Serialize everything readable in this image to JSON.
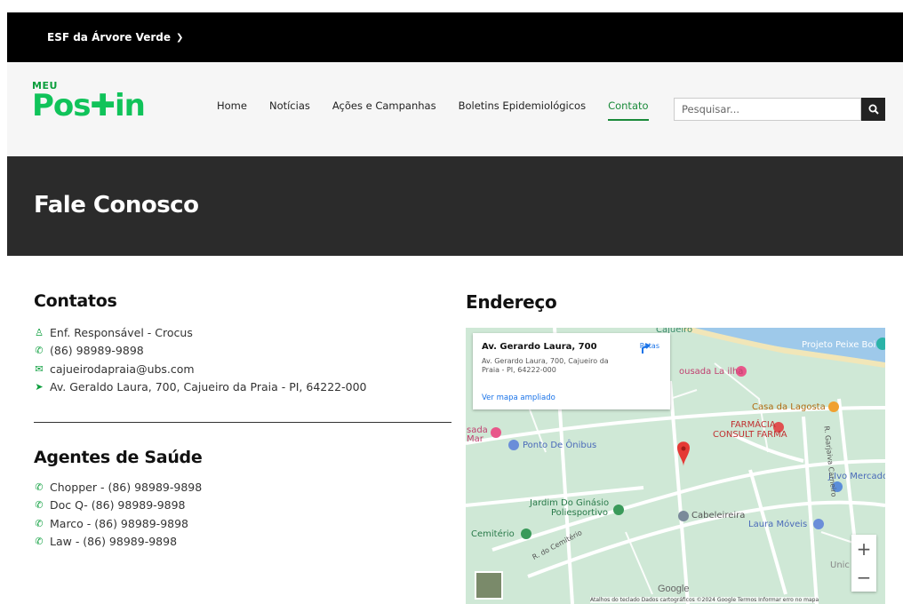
{
  "topbar": {
    "unit": "ESF da Árvore Verde"
  },
  "logo": {
    "small": "MEU",
    "main_a": "Pos",
    "main_b": "in"
  },
  "nav": {
    "items": [
      {
        "label": "Home"
      },
      {
        "label": "Notícias"
      },
      {
        "label": "Ações e Campanhas"
      },
      {
        "label": "Boletins Epidemiológicos"
      },
      {
        "label": "Contato",
        "active": true
      }
    ]
  },
  "search": {
    "placeholder": "Pesquisar..."
  },
  "hero": {
    "title": "Fale Conosco"
  },
  "contacts": {
    "heading": "Contatos",
    "items": [
      {
        "icon": "nurse-icon",
        "text": "Enf. Responsável - Crocus"
      },
      {
        "icon": "whatsapp-icon",
        "text": "(86) 98989-9898"
      },
      {
        "icon": "email-icon",
        "text": "cajueirodapraia@ubs.com"
      },
      {
        "icon": "location-arrow-icon",
        "text": "Av. Geraldo Laura, 700, Cajueiro da Praia - PI, 64222-000"
      }
    ]
  },
  "agents": {
    "heading": "Agentes de Saúde",
    "items": [
      {
        "icon": "whatsapp-icon",
        "text": "Chopper - (86) 98989-9898"
      },
      {
        "icon": "whatsapp-icon",
        "text": "Doc Q- (86) 98989-9898"
      },
      {
        "icon": "whatsapp-icon",
        "text": "Marco - (86) 98989-9898"
      },
      {
        "icon": "whatsapp-icon",
        "text": "Law - (86) 98989-9898"
      }
    ]
  },
  "address": {
    "heading": "Endereço",
    "card_title": "Av. Gerardo Laura, 700",
    "card_address": "Av. Gerardo Laura, 700, Cajueiro da Praia - PI, 64222-000",
    "card_link": "Ver mapa ampliado",
    "card_directions": "Rotas"
  },
  "map": {
    "labels": {
      "cajueiro": "Cajueiro",
      "projeto": "Projeto Peixe Boi",
      "pousada_ilha": "ousada La ilha",
      "casa_lagosta": "Casa da Lagosta",
      "farmacia": "FARMÁCIA",
      "consult": "CONSULT FARMA",
      "pousada_mar_a": "sada",
      "pousada_mar_b": "Mar",
      "ponto_onibus": "Ponto De Ônibus",
      "jivo": "J.Ivo Mercado",
      "rua_garjaiva": "R. Garjaiva Carneiro",
      "jardim_a": "Jardim Do Ginásio",
      "jardim_b": "Poliesportivo",
      "cabeleireira": "Cabeleireira",
      "laura": "Laura Móveis",
      "cemiterio": "Cemitério",
      "rua_cemiterio": "R. do Cemitério",
      "unic": "Unic",
      "google": "Google",
      "attribution": "Atalhos do teclado   Dados cartográficos ©2024 Google   Termos   Informar erro no mapa"
    },
    "colors": {
      "land": "#cfe8d6",
      "water": "#9ec9ea",
      "road": "#ffffff",
      "pin": "#e53935"
    }
  }
}
